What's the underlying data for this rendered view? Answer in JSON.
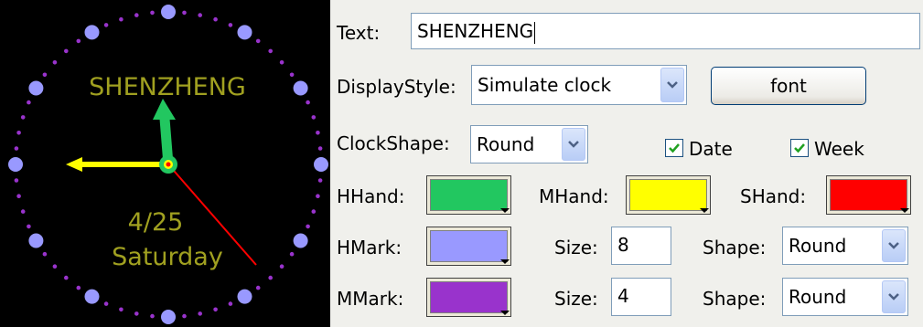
{
  "clock": {
    "text": "SHENZHENG",
    "date": "4/25",
    "week": "Saturday"
  },
  "colors": {
    "hour_hand": "#22c760",
    "minute_hand": "#ffff00",
    "second_hand": "#ff0000",
    "hour_mark": "#9999ff",
    "minute_mark": "#9933cc",
    "clock_text": "#a0a020"
  },
  "form": {
    "text_label": "Text:",
    "text_value": "SHENZHENG",
    "display_style_label": "DisplayStyle:",
    "display_style_value": "Simulate clock",
    "font_button": "font",
    "clock_shape_label": "ClockShape:",
    "clock_shape_value": "Round",
    "date_label": "Date",
    "date_checked": true,
    "week_label": "Week",
    "week_checked": true,
    "hhand_label": "HHand:",
    "mhand_label": "MHand:",
    "shand_label": "SHand:",
    "hmark_label": "HMark:",
    "hmark_size_label": "Size:",
    "hmark_size_value": "8",
    "hmark_shape_label": "Shape:",
    "hmark_shape_value": "Round",
    "mmark_label": "MMark:",
    "mmark_size_label": "Size:",
    "mmark_size_value": "4",
    "mmark_shape_label": "Shape:",
    "mmark_shape_value": "Round"
  }
}
